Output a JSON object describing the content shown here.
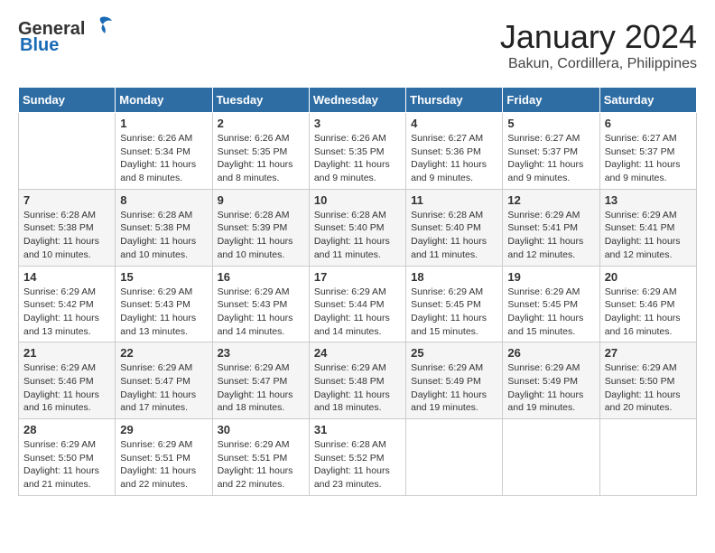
{
  "logo": {
    "general": "General",
    "blue": "Blue"
  },
  "title": {
    "month_year": "January 2024",
    "location": "Bakun, Cordillera, Philippines"
  },
  "header_days": [
    "Sunday",
    "Monday",
    "Tuesday",
    "Wednesday",
    "Thursday",
    "Friday",
    "Saturday"
  ],
  "weeks": [
    [
      {
        "day": "",
        "sunrise": "",
        "sunset": "",
        "daylight": ""
      },
      {
        "day": "1",
        "sunrise": "Sunrise: 6:26 AM",
        "sunset": "Sunset: 5:34 PM",
        "daylight": "Daylight: 11 hours and 8 minutes."
      },
      {
        "day": "2",
        "sunrise": "Sunrise: 6:26 AM",
        "sunset": "Sunset: 5:35 PM",
        "daylight": "Daylight: 11 hours and 8 minutes."
      },
      {
        "day": "3",
        "sunrise": "Sunrise: 6:26 AM",
        "sunset": "Sunset: 5:35 PM",
        "daylight": "Daylight: 11 hours and 9 minutes."
      },
      {
        "day": "4",
        "sunrise": "Sunrise: 6:27 AM",
        "sunset": "Sunset: 5:36 PM",
        "daylight": "Daylight: 11 hours and 9 minutes."
      },
      {
        "day": "5",
        "sunrise": "Sunrise: 6:27 AM",
        "sunset": "Sunset: 5:37 PM",
        "daylight": "Daylight: 11 hours and 9 minutes."
      },
      {
        "day": "6",
        "sunrise": "Sunrise: 6:27 AM",
        "sunset": "Sunset: 5:37 PM",
        "daylight": "Daylight: 11 hours and 9 minutes."
      }
    ],
    [
      {
        "day": "7",
        "sunrise": "Sunrise: 6:28 AM",
        "sunset": "Sunset: 5:38 PM",
        "daylight": "Daylight: 11 hours and 10 minutes."
      },
      {
        "day": "8",
        "sunrise": "Sunrise: 6:28 AM",
        "sunset": "Sunset: 5:38 PM",
        "daylight": "Daylight: 11 hours and 10 minutes."
      },
      {
        "day": "9",
        "sunrise": "Sunrise: 6:28 AM",
        "sunset": "Sunset: 5:39 PM",
        "daylight": "Daylight: 11 hours and 10 minutes."
      },
      {
        "day": "10",
        "sunrise": "Sunrise: 6:28 AM",
        "sunset": "Sunset: 5:40 PM",
        "daylight": "Daylight: 11 hours and 11 minutes."
      },
      {
        "day": "11",
        "sunrise": "Sunrise: 6:28 AM",
        "sunset": "Sunset: 5:40 PM",
        "daylight": "Daylight: 11 hours and 11 minutes."
      },
      {
        "day": "12",
        "sunrise": "Sunrise: 6:29 AM",
        "sunset": "Sunset: 5:41 PM",
        "daylight": "Daylight: 11 hours and 12 minutes."
      },
      {
        "day": "13",
        "sunrise": "Sunrise: 6:29 AM",
        "sunset": "Sunset: 5:41 PM",
        "daylight": "Daylight: 11 hours and 12 minutes."
      }
    ],
    [
      {
        "day": "14",
        "sunrise": "Sunrise: 6:29 AM",
        "sunset": "Sunset: 5:42 PM",
        "daylight": "Daylight: 11 hours and 13 minutes."
      },
      {
        "day": "15",
        "sunrise": "Sunrise: 6:29 AM",
        "sunset": "Sunset: 5:43 PM",
        "daylight": "Daylight: 11 hours and 13 minutes."
      },
      {
        "day": "16",
        "sunrise": "Sunrise: 6:29 AM",
        "sunset": "Sunset: 5:43 PM",
        "daylight": "Daylight: 11 hours and 14 minutes."
      },
      {
        "day": "17",
        "sunrise": "Sunrise: 6:29 AM",
        "sunset": "Sunset: 5:44 PM",
        "daylight": "Daylight: 11 hours and 14 minutes."
      },
      {
        "day": "18",
        "sunrise": "Sunrise: 6:29 AM",
        "sunset": "Sunset: 5:45 PM",
        "daylight": "Daylight: 11 hours and 15 minutes."
      },
      {
        "day": "19",
        "sunrise": "Sunrise: 6:29 AM",
        "sunset": "Sunset: 5:45 PM",
        "daylight": "Daylight: 11 hours and 15 minutes."
      },
      {
        "day": "20",
        "sunrise": "Sunrise: 6:29 AM",
        "sunset": "Sunset: 5:46 PM",
        "daylight": "Daylight: 11 hours and 16 minutes."
      }
    ],
    [
      {
        "day": "21",
        "sunrise": "Sunrise: 6:29 AM",
        "sunset": "Sunset: 5:46 PM",
        "daylight": "Daylight: 11 hours and 16 minutes."
      },
      {
        "day": "22",
        "sunrise": "Sunrise: 6:29 AM",
        "sunset": "Sunset: 5:47 PM",
        "daylight": "Daylight: 11 hours and 17 minutes."
      },
      {
        "day": "23",
        "sunrise": "Sunrise: 6:29 AM",
        "sunset": "Sunset: 5:47 PM",
        "daylight": "Daylight: 11 hours and 18 minutes."
      },
      {
        "day": "24",
        "sunrise": "Sunrise: 6:29 AM",
        "sunset": "Sunset: 5:48 PM",
        "daylight": "Daylight: 11 hours and 18 minutes."
      },
      {
        "day": "25",
        "sunrise": "Sunrise: 6:29 AM",
        "sunset": "Sunset: 5:49 PM",
        "daylight": "Daylight: 11 hours and 19 minutes."
      },
      {
        "day": "26",
        "sunrise": "Sunrise: 6:29 AM",
        "sunset": "Sunset: 5:49 PM",
        "daylight": "Daylight: 11 hours and 19 minutes."
      },
      {
        "day": "27",
        "sunrise": "Sunrise: 6:29 AM",
        "sunset": "Sunset: 5:50 PM",
        "daylight": "Daylight: 11 hours and 20 minutes."
      }
    ],
    [
      {
        "day": "28",
        "sunrise": "Sunrise: 6:29 AM",
        "sunset": "Sunset: 5:50 PM",
        "daylight": "Daylight: 11 hours and 21 minutes."
      },
      {
        "day": "29",
        "sunrise": "Sunrise: 6:29 AM",
        "sunset": "Sunset: 5:51 PM",
        "daylight": "Daylight: 11 hours and 22 minutes."
      },
      {
        "day": "30",
        "sunrise": "Sunrise: 6:29 AM",
        "sunset": "Sunset: 5:51 PM",
        "daylight": "Daylight: 11 hours and 22 minutes."
      },
      {
        "day": "31",
        "sunrise": "Sunrise: 6:28 AM",
        "sunset": "Sunset: 5:52 PM",
        "daylight": "Daylight: 11 hours and 23 minutes."
      },
      {
        "day": "",
        "sunrise": "",
        "sunset": "",
        "daylight": ""
      },
      {
        "day": "",
        "sunrise": "",
        "sunset": "",
        "daylight": ""
      },
      {
        "day": "",
        "sunrise": "",
        "sunset": "",
        "daylight": ""
      }
    ]
  ]
}
